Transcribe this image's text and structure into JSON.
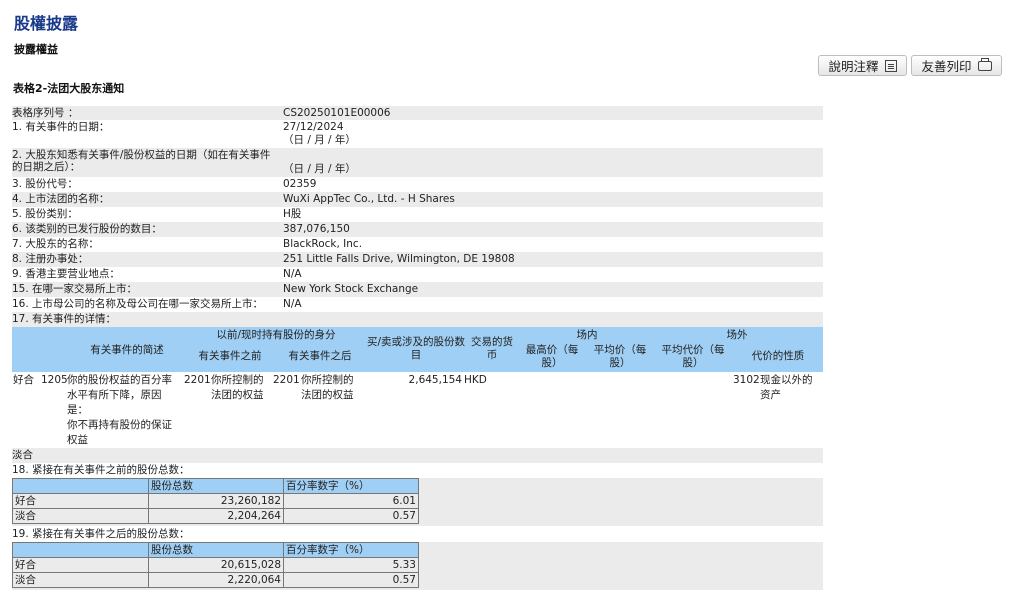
{
  "page": {
    "title": "股權披露",
    "subtitle": "披露權益",
    "form_title": "表格2-法团大股东通知"
  },
  "buttons": {
    "notes": "說明注釋",
    "print": "友善列印"
  },
  "fields": [
    {
      "label": "表格序列号 ：",
      "value": "CS20250101E00006",
      "value2": ""
    },
    {
      "label": "1. 有关事件的日期：",
      "value": "27/12/2024",
      "value2": "（日 / 月 / 年）"
    },
    {
      "label": "2. 大股东知悉有关事件/股份权益的日期（如在有关事件的日期之后）：",
      "value": "",
      "value2": "（日 / 月 / 年）"
    },
    {
      "label": "3. 股份代号：",
      "value": "02359",
      "value2": ""
    },
    {
      "label": "4. 上市法团的名称：",
      "value": "WuXi AppTec Co., Ltd. - H Shares",
      "value2": ""
    },
    {
      "label": "5. 股份类别：",
      "value": "H股",
      "value2": ""
    },
    {
      "label": "6. 该类别的已发行股份的数目：",
      "value": "387,076,150",
      "value2": ""
    },
    {
      "label": "7. 大股东的名称：",
      "value": "BlackRock, Inc.",
      "value2": ""
    },
    {
      "label": "8. 注册办事处：",
      "value": "251 Little Falls Drive, Wilmington, DE 19808",
      "value2": ""
    },
    {
      "label": "9. 香港主要营业地点：",
      "value": "N/A",
      "value2": ""
    },
    {
      "label": "15. 在哪一家交易所上市：",
      "value": "New York Stock Exchange",
      "value2": ""
    },
    {
      "label": "16. 上市母公司的名称及母公司在哪一家交易所上市：",
      "value": "N/A",
      "value2": ""
    },
    {
      "label": "17. 有关事件的详情：",
      "value": "",
      "value2": ""
    }
  ],
  "event_table": {
    "headers": {
      "event_summary": "有关事件的简述",
      "capacity_group": "以前/现时持有股份的身分",
      "before": "有关事件之前",
      "after": "有关事件之后",
      "shares": "买/卖或涉及的股份数目",
      "currency": "交易的货币",
      "on_exchange": "场内",
      "highest": "最高价（每股）",
      "average": "平均价（每股）",
      "off_exchange": "场外",
      "avg_consideration": "平均代价（每股）",
      "consideration_nature": "代价的性质"
    },
    "row": {
      "position": "好合",
      "code": "1205",
      "summary_1": "你的股份权益的百分率水平有所下降，原因是：",
      "summary_2": "你不再持有股份的保证权益",
      "before_code": "2201",
      "before_desc": "你所控制的法团的权益",
      "after_code": "2201",
      "after_desc": "你所控制的法团的权益",
      "shares": "2,645,154",
      "currency": "HKD",
      "off_code": "3102",
      "consideration": "现金以外的资产"
    },
    "short_row": "淡合"
  },
  "section18": {
    "label": "18. 紧接在有关事件之前的股份总数：",
    "col_shares": "股份总数",
    "col_pct": "百分率数字（%）",
    "rows": [
      {
        "type": "好合",
        "shares": "23,260,182",
        "pct": "6.01"
      },
      {
        "type": "淡合",
        "shares": "2,204,264",
        "pct": "0.57"
      }
    ]
  },
  "section19": {
    "label": "19. 紧接在有关事件之后的股份总数：",
    "col_shares": "股份总数",
    "col_pct": "百分率数字（%）",
    "rows": [
      {
        "type": "好合",
        "shares": "20,615,028",
        "pct": "5.33"
      },
      {
        "type": "淡合",
        "shares": "2,220,064",
        "pct": "0.57"
      }
    ]
  },
  "colors": {
    "title": "#1a3a8a",
    "header_bg": "#9fcff4",
    "row_alt": "#ebebeb"
  }
}
